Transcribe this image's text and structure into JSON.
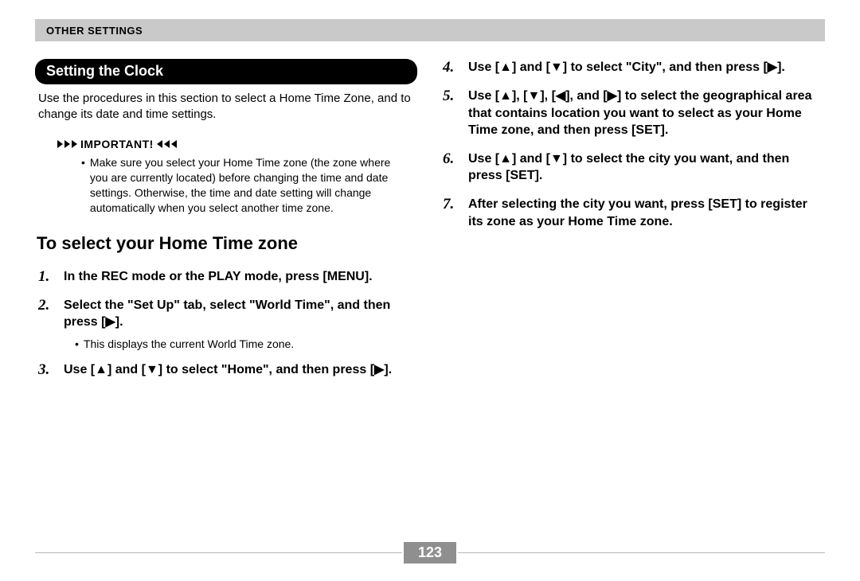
{
  "header": {
    "breadcrumb": "OTHER SETTINGS"
  },
  "section": {
    "title": "Setting the Clock",
    "intro": "Use the procedures in this section to select a Home Time Zone, and to change its date and time settings."
  },
  "important": {
    "label": "IMPORTANT!",
    "note": "Make sure you select your Home Time zone (the zone where you are currently located) before changing the time and date settings. Otherwise, the time and date setting will change automatically when you select another time zone."
  },
  "subheading": "To select your Home Time zone",
  "steps_left": [
    {
      "text": "In the REC mode or the PLAY mode, press [MENU].",
      "note": null
    },
    {
      "text": "Select the \"Set Up\" tab, select \"World Time\", and then press [▶].",
      "note": "This displays the current World Time zone."
    },
    {
      "text": "Use [▲] and [▼] to select \"Home\", and then press [▶].",
      "note": null
    }
  ],
  "steps_right": [
    {
      "text": "Use [▲] and [▼] to select \"City\", and then press [▶].",
      "note": null
    },
    {
      "text": "Use [▲], [▼], [◀], and [▶] to select the geographical area that contains location you want to select as your Home Time zone, and then press [SET].",
      "note": null
    },
    {
      "text": "Use [▲] and [▼] to select the city you want, and then press [SET].",
      "note": null
    },
    {
      "text": "After selecting the city you want, press [SET] to register its zone as your Home Time zone.",
      "note": null
    }
  ],
  "page_number": "123"
}
